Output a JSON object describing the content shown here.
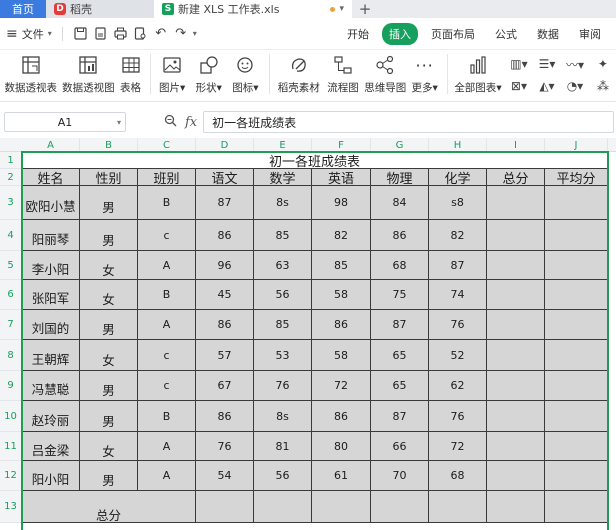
{
  "tabs": {
    "home": "首页",
    "daoke": "稻壳",
    "file": "新建 XLS 工作表.xls",
    "add": "+"
  },
  "menu": {
    "file": "文件",
    "tabs": [
      "开始",
      "插入",
      "页面布局",
      "公式",
      "数据",
      "审阅"
    ],
    "active_tab": "插入"
  },
  "ribbon": {
    "buttons": [
      {
        "label": "数据透视表",
        "icon": "pivot-table-icon"
      },
      {
        "label": "数据透视图",
        "icon": "pivot-chart-icon"
      },
      {
        "label": "表格",
        "icon": "table-icon"
      },
      {
        "label": "图片",
        "icon": "picture-icon"
      },
      {
        "label": "形状",
        "icon": "shape-icon"
      },
      {
        "label": "图标",
        "icon": "icon-library-icon"
      },
      {
        "label": "稻壳素材",
        "icon": "daoke-material-icon"
      },
      {
        "label": "流程图",
        "icon": "flowchart-icon"
      },
      {
        "label": "思维导图",
        "icon": "mindmap-icon"
      },
      {
        "label": "更多",
        "icon": "more-icon"
      },
      {
        "label": "全部图表",
        "icon": "all-charts-icon"
      }
    ]
  },
  "formula_bar": {
    "cell_ref": "A1",
    "content": "初一各班成绩表"
  },
  "columns": [
    "A",
    "B",
    "C",
    "D",
    "E",
    "F",
    "G",
    "H",
    "I",
    "J"
  ],
  "rows": [
    "1",
    "2",
    "3",
    "4",
    "5",
    "6",
    "7",
    "8",
    "9",
    "10",
    "11",
    "12",
    "13"
  ],
  "sheet": {
    "title": "初一各班成绩表",
    "headers": [
      "姓名",
      "性别",
      "班别",
      "语文",
      "数学",
      "英语",
      "物理",
      "化学",
      "总分",
      "平均分"
    ],
    "records": [
      [
        "欧阳小慧",
        "男",
        "B",
        "87",
        "8s",
        "98",
        "84",
        "s8",
        "",
        ""
      ],
      [
        "阳丽琴",
        "男",
        "c",
        "86",
        "85",
        "82",
        "86",
        "82",
        "",
        ""
      ],
      [
        "李小阳",
        "女",
        "A",
        "96",
        "63",
        "85",
        "68",
        "87",
        "",
        ""
      ],
      [
        "张阳军",
        "女",
        "B",
        "45",
        "56",
        "58",
        "75",
        "74",
        "",
        ""
      ],
      [
        "刘国的",
        "男",
        "A",
        "86",
        "85",
        "86",
        "87",
        "76",
        "",
        ""
      ],
      [
        "王朝辉",
        "女",
        "c",
        "57",
        "53",
        "58",
        "65",
        "52",
        "",
        ""
      ],
      [
        "冯慧聪",
        "男",
        "c",
        "67",
        "76",
        "72",
        "65",
        "62",
        "",
        ""
      ],
      [
        "赵玲丽",
        "男",
        "B",
        "86",
        "8s",
        "86",
        "87",
        "76",
        "",
        ""
      ],
      [
        "吕金梁",
        "女",
        "A",
        "76",
        "81",
        "80",
        "66",
        "72",
        "",
        ""
      ],
      [
        "阳小阳",
        "男",
        "A",
        "54",
        "56",
        "61",
        "70",
        "68",
        "",
        ""
      ]
    ],
    "total_label": "总分"
  }
}
